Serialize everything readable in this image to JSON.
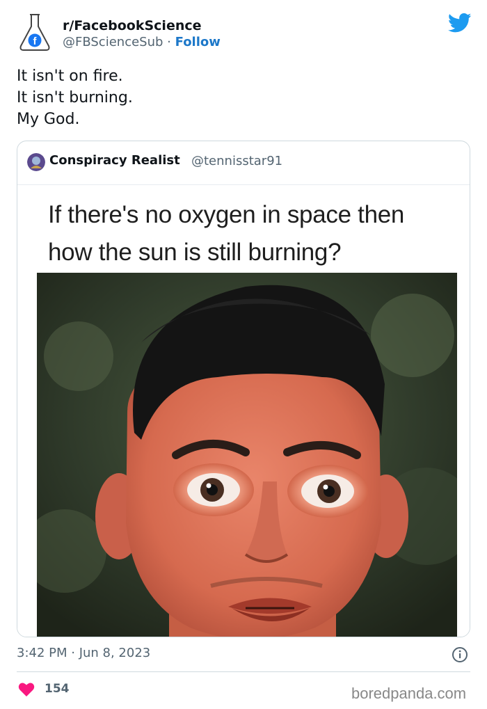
{
  "author": {
    "display_name": "r/FacebookScience",
    "handle": "@FBScienceSub",
    "separator": "·",
    "follow_label": "Follow"
  },
  "tweet": {
    "lines": [
      "It isn't on fire.",
      "It isn't burning.",
      "My God."
    ],
    "timestamp": "3:42 PM · Jun 8, 2023",
    "likes": "154"
  },
  "quoted_tweet": {
    "display_name": "Conspiracy Realist",
    "handle": "@tennisstar91",
    "meme_caption_lines": [
      "If there's no oxygen in space then",
      "how the sun is still burning?"
    ]
  },
  "watermark": "boredpanda.com",
  "icons": {
    "avatar": "flask-facebook-avatar",
    "platform": "twitter-bird-icon",
    "info": "info-icon",
    "like": "heart-icon"
  },
  "colors": {
    "follow": "#1d78c9",
    "twitter_blue": "#1d9bf0",
    "heart": "#f91880",
    "muted_text": "#536471"
  }
}
